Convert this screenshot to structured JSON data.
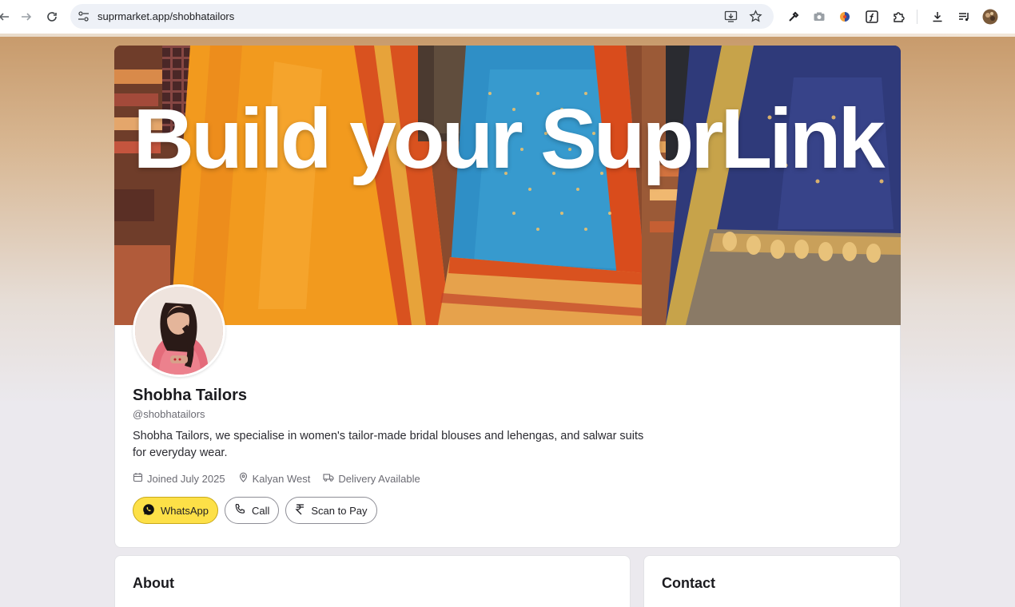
{
  "browser": {
    "url": "suprmarket.app/shobhatailors",
    "icons": [
      "back-arrow-icon",
      "forward-arrow-icon",
      "reload-icon",
      "site-settings-icon",
      "install-app-icon",
      "bookmark-star-icon",
      "eyedropper-icon",
      "camera-icon",
      "extension-icon",
      "font-icon",
      "puzzle-icon",
      "download-icon",
      "media-control-icon",
      "profile-avatar"
    ]
  },
  "banner": {
    "title": "Build your SuprLink"
  },
  "profile": {
    "name": "Shobha Tailors",
    "handle": "@shobhatailors",
    "bio": "Shobha Tailors, we specialise in women's tailor-made bridal blouses and lehengas, and salwar suits for everyday wear.",
    "joined": "Joined July 2025",
    "location": "Kalyan West",
    "delivery": "Delivery Available"
  },
  "actions": {
    "whatsapp": "WhatsApp",
    "call": "Call",
    "scan": "Scan to Pay"
  },
  "sections": {
    "about": "About",
    "contact": "Contact"
  },
  "colors": {
    "whatsapp_button": "#fde047",
    "banner_orange": "#f29a1e",
    "banner_blue": "#2f8fc6",
    "banner_navy": "#2f3a7a"
  }
}
